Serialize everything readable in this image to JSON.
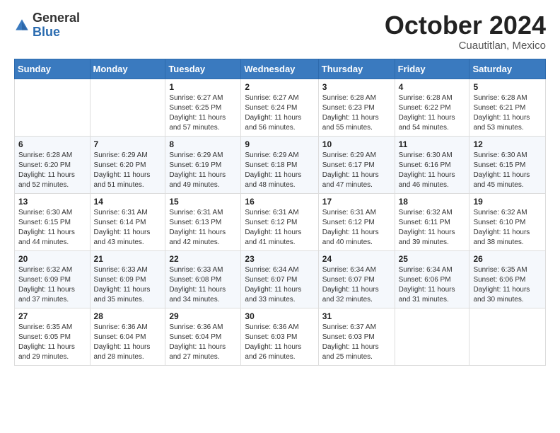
{
  "logo": {
    "general": "General",
    "blue": "Blue"
  },
  "title": {
    "month": "October 2024",
    "location": "Cuautitlan, Mexico"
  },
  "headers": [
    "Sunday",
    "Monday",
    "Tuesday",
    "Wednesday",
    "Thursday",
    "Friday",
    "Saturday"
  ],
  "weeks": [
    [
      {
        "day": "",
        "sunrise": "",
        "sunset": "",
        "daylight": ""
      },
      {
        "day": "",
        "sunrise": "",
        "sunset": "",
        "daylight": ""
      },
      {
        "day": "1",
        "sunrise": "Sunrise: 6:27 AM",
        "sunset": "Sunset: 6:25 PM",
        "daylight": "Daylight: 11 hours and 57 minutes."
      },
      {
        "day": "2",
        "sunrise": "Sunrise: 6:27 AM",
        "sunset": "Sunset: 6:24 PM",
        "daylight": "Daylight: 11 hours and 56 minutes."
      },
      {
        "day": "3",
        "sunrise": "Sunrise: 6:28 AM",
        "sunset": "Sunset: 6:23 PM",
        "daylight": "Daylight: 11 hours and 55 minutes."
      },
      {
        "day": "4",
        "sunrise": "Sunrise: 6:28 AM",
        "sunset": "Sunset: 6:22 PM",
        "daylight": "Daylight: 11 hours and 54 minutes."
      },
      {
        "day": "5",
        "sunrise": "Sunrise: 6:28 AM",
        "sunset": "Sunset: 6:21 PM",
        "daylight": "Daylight: 11 hours and 53 minutes."
      }
    ],
    [
      {
        "day": "6",
        "sunrise": "Sunrise: 6:28 AM",
        "sunset": "Sunset: 6:20 PM",
        "daylight": "Daylight: 11 hours and 52 minutes."
      },
      {
        "day": "7",
        "sunrise": "Sunrise: 6:29 AM",
        "sunset": "Sunset: 6:20 PM",
        "daylight": "Daylight: 11 hours and 51 minutes."
      },
      {
        "day": "8",
        "sunrise": "Sunrise: 6:29 AM",
        "sunset": "Sunset: 6:19 PM",
        "daylight": "Daylight: 11 hours and 49 minutes."
      },
      {
        "day": "9",
        "sunrise": "Sunrise: 6:29 AM",
        "sunset": "Sunset: 6:18 PM",
        "daylight": "Daylight: 11 hours and 48 minutes."
      },
      {
        "day": "10",
        "sunrise": "Sunrise: 6:29 AM",
        "sunset": "Sunset: 6:17 PM",
        "daylight": "Daylight: 11 hours and 47 minutes."
      },
      {
        "day": "11",
        "sunrise": "Sunrise: 6:30 AM",
        "sunset": "Sunset: 6:16 PM",
        "daylight": "Daylight: 11 hours and 46 minutes."
      },
      {
        "day": "12",
        "sunrise": "Sunrise: 6:30 AM",
        "sunset": "Sunset: 6:15 PM",
        "daylight": "Daylight: 11 hours and 45 minutes."
      }
    ],
    [
      {
        "day": "13",
        "sunrise": "Sunrise: 6:30 AM",
        "sunset": "Sunset: 6:15 PM",
        "daylight": "Daylight: 11 hours and 44 minutes."
      },
      {
        "day": "14",
        "sunrise": "Sunrise: 6:31 AM",
        "sunset": "Sunset: 6:14 PM",
        "daylight": "Daylight: 11 hours and 43 minutes."
      },
      {
        "day": "15",
        "sunrise": "Sunrise: 6:31 AM",
        "sunset": "Sunset: 6:13 PM",
        "daylight": "Daylight: 11 hours and 42 minutes."
      },
      {
        "day": "16",
        "sunrise": "Sunrise: 6:31 AM",
        "sunset": "Sunset: 6:12 PM",
        "daylight": "Daylight: 11 hours and 41 minutes."
      },
      {
        "day": "17",
        "sunrise": "Sunrise: 6:31 AM",
        "sunset": "Sunset: 6:12 PM",
        "daylight": "Daylight: 11 hours and 40 minutes."
      },
      {
        "day": "18",
        "sunrise": "Sunrise: 6:32 AM",
        "sunset": "Sunset: 6:11 PM",
        "daylight": "Daylight: 11 hours and 39 minutes."
      },
      {
        "day": "19",
        "sunrise": "Sunrise: 6:32 AM",
        "sunset": "Sunset: 6:10 PM",
        "daylight": "Daylight: 11 hours and 38 minutes."
      }
    ],
    [
      {
        "day": "20",
        "sunrise": "Sunrise: 6:32 AM",
        "sunset": "Sunset: 6:09 PM",
        "daylight": "Daylight: 11 hours and 37 minutes."
      },
      {
        "day": "21",
        "sunrise": "Sunrise: 6:33 AM",
        "sunset": "Sunset: 6:09 PM",
        "daylight": "Daylight: 11 hours and 35 minutes."
      },
      {
        "day": "22",
        "sunrise": "Sunrise: 6:33 AM",
        "sunset": "Sunset: 6:08 PM",
        "daylight": "Daylight: 11 hours and 34 minutes."
      },
      {
        "day": "23",
        "sunrise": "Sunrise: 6:34 AM",
        "sunset": "Sunset: 6:07 PM",
        "daylight": "Daylight: 11 hours and 33 minutes."
      },
      {
        "day": "24",
        "sunrise": "Sunrise: 6:34 AM",
        "sunset": "Sunset: 6:07 PM",
        "daylight": "Daylight: 11 hours and 32 minutes."
      },
      {
        "day": "25",
        "sunrise": "Sunrise: 6:34 AM",
        "sunset": "Sunset: 6:06 PM",
        "daylight": "Daylight: 11 hours and 31 minutes."
      },
      {
        "day": "26",
        "sunrise": "Sunrise: 6:35 AM",
        "sunset": "Sunset: 6:06 PM",
        "daylight": "Daylight: 11 hours and 30 minutes."
      }
    ],
    [
      {
        "day": "27",
        "sunrise": "Sunrise: 6:35 AM",
        "sunset": "Sunset: 6:05 PM",
        "daylight": "Daylight: 11 hours and 29 minutes."
      },
      {
        "day": "28",
        "sunrise": "Sunrise: 6:36 AM",
        "sunset": "Sunset: 6:04 PM",
        "daylight": "Daylight: 11 hours and 28 minutes."
      },
      {
        "day": "29",
        "sunrise": "Sunrise: 6:36 AM",
        "sunset": "Sunset: 6:04 PM",
        "daylight": "Daylight: 11 hours and 27 minutes."
      },
      {
        "day": "30",
        "sunrise": "Sunrise: 6:36 AM",
        "sunset": "Sunset: 6:03 PM",
        "daylight": "Daylight: 11 hours and 26 minutes."
      },
      {
        "day": "31",
        "sunrise": "Sunrise: 6:37 AM",
        "sunset": "Sunset: 6:03 PM",
        "daylight": "Daylight: 11 hours and 25 minutes."
      },
      {
        "day": "",
        "sunrise": "",
        "sunset": "",
        "daylight": ""
      },
      {
        "day": "",
        "sunrise": "",
        "sunset": "",
        "daylight": ""
      }
    ]
  ]
}
